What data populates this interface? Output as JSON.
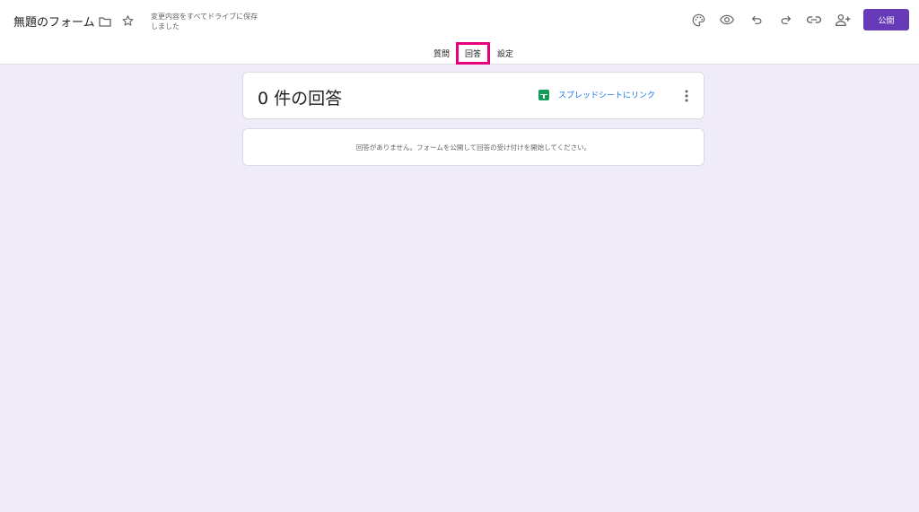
{
  "header": {
    "title": "無題のフォーム",
    "save_status": "変更内容をすべてドライブに保存しました",
    "icons": [
      "folder-icon",
      "star-icon",
      "palette-icon",
      "eye-icon",
      "undo-icon",
      "redo-icon",
      "link-icon",
      "add-person-icon"
    ],
    "publish_label": "公開",
    "accent_color": "#673ab7"
  },
  "tabs": [
    {
      "label": "質問",
      "active": false
    },
    {
      "label": "回答",
      "active": true
    },
    {
      "label": "設定",
      "active": false
    }
  ],
  "responses": {
    "count_title": "0 件の回答",
    "sheets_link_label": "スプレッドシートにリンク",
    "empty_message": "回答がありません。フォームを公開して回答の受け付けを開始してください。"
  },
  "colors": {
    "background": "#f0ebf8",
    "highlight": "#e6007e",
    "link": "#1a73e8",
    "sheets": "#0f9d58"
  }
}
